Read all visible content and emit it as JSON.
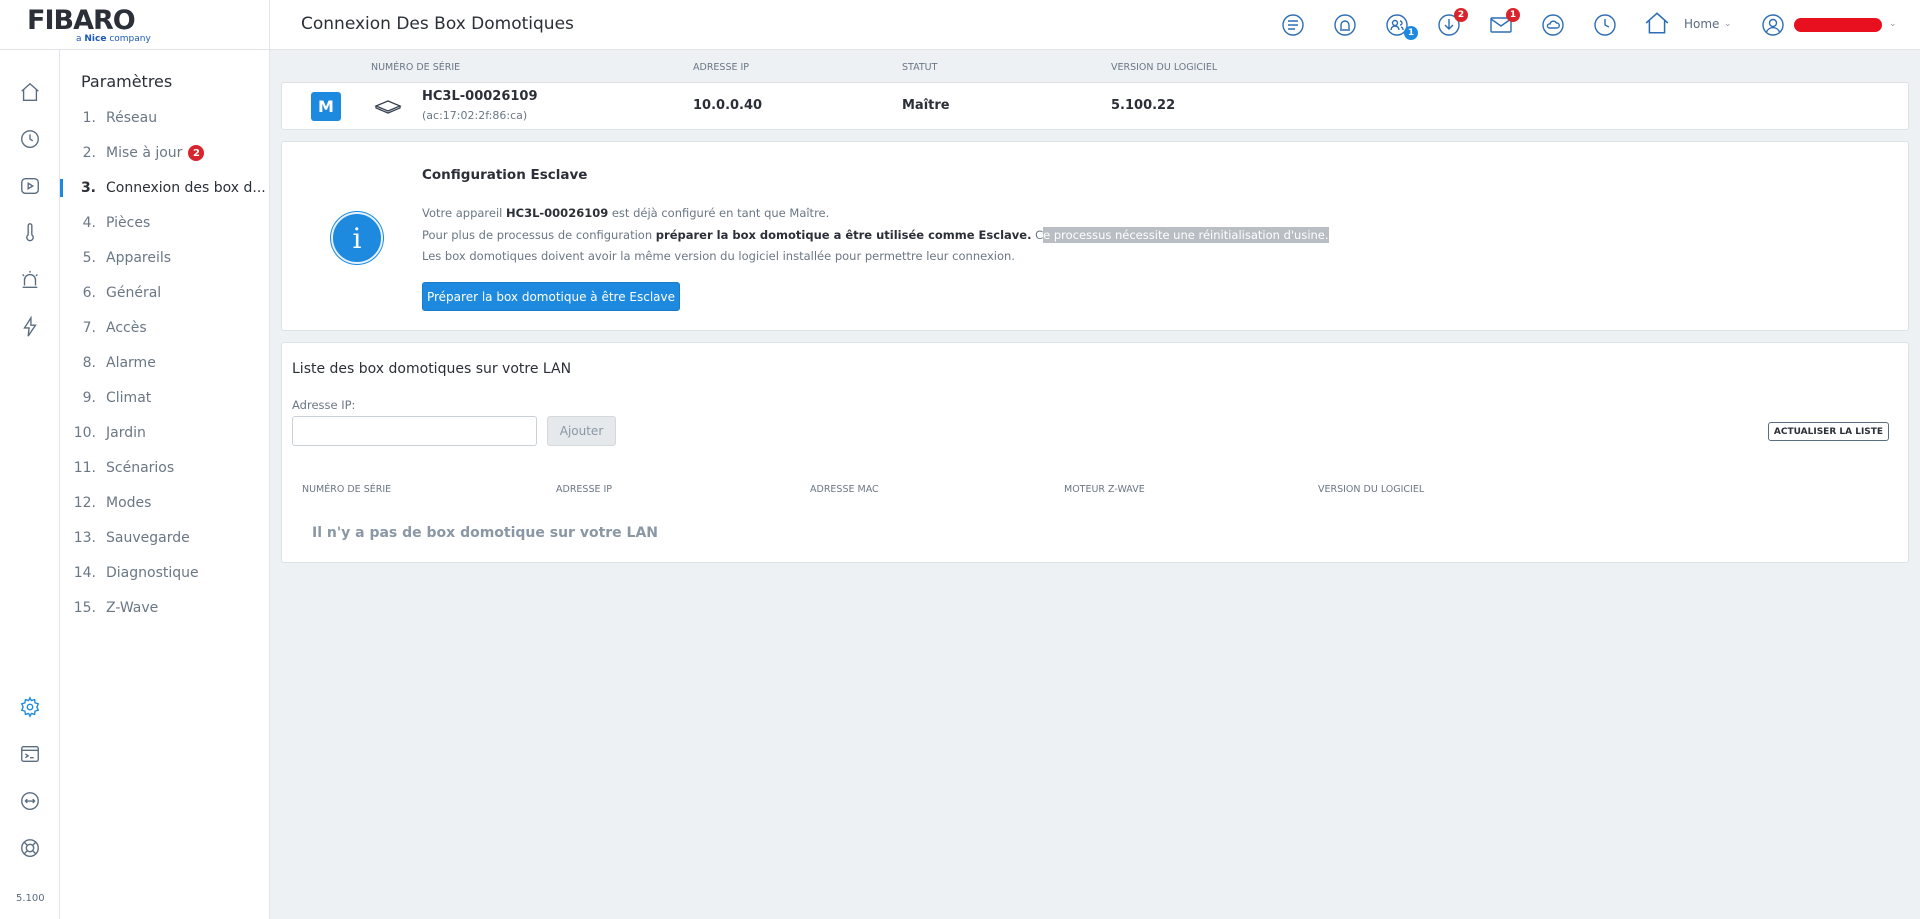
{
  "brand": {
    "logo": "FIBARO",
    "sub_prefix": "a",
    "sub_bold": "Nice",
    "sub_suffix": "company"
  },
  "app_version": "5.100",
  "header": {
    "title": "Connexion Des Box Domotiques",
    "home_label": "Home",
    "badges": {
      "users": "1",
      "downloads": "2",
      "messages": "1"
    }
  },
  "nav": {
    "title": "Paramètres",
    "items": [
      {
        "num": "1.",
        "label": "Réseau"
      },
      {
        "num": "2.",
        "label": "Mise à jour",
        "badge": "2"
      },
      {
        "num": "3.",
        "label": "Connexion des box d..."
      },
      {
        "num": "4.",
        "label": "Pièces"
      },
      {
        "num": "5.",
        "label": "Appareils"
      },
      {
        "num": "6.",
        "label": "Général"
      },
      {
        "num": "7.",
        "label": "Accès"
      },
      {
        "num": "8.",
        "label": "Alarme"
      },
      {
        "num": "9.",
        "label": "Climat"
      },
      {
        "num": "10.",
        "label": "Jardin"
      },
      {
        "num": "11.",
        "label": "Scénarios"
      },
      {
        "num": "12.",
        "label": "Modes"
      },
      {
        "num": "13.",
        "label": "Sauvegarde"
      },
      {
        "num": "14.",
        "label": "Diagnostique"
      },
      {
        "num": "15.",
        "label": "Z-Wave"
      }
    ]
  },
  "device_table": {
    "headers": {
      "serial": "NUMÉRO DE SÉRIE",
      "ip": "ADRESSE IP",
      "status": "STATUT",
      "version": "VERSION DU LOGICIEL"
    },
    "row": {
      "role_letter": "M",
      "serial": "HC3L-00026109",
      "mac": "(ac:17:02:2f:86:ca)",
      "ip": "10.0.0.40",
      "status": "Maître",
      "version": "5.100.22"
    }
  },
  "config": {
    "title": "Configuration Esclave",
    "line1_a": "Votre appareil ",
    "line1_b": "HC3L-00026109",
    "line1_c": " est déjà configuré en tant que Maître.",
    "line2_a": "Pour plus de processus de configuration ",
    "line2_b": "préparer la box domotique a être utilisée comme Esclave.",
    "line2_c": " C",
    "line2_d": "e processus nécessite une réinitialisation d'usine.",
    "line3": "Les box domotiques doivent avoir la même version du logiciel installée pour permettre leur connexion.",
    "button": "Préparer la box domotique à être Esclave"
  },
  "lan": {
    "title": "Liste des box domotiques sur votre LAN",
    "ip_label": "Adresse IP:",
    "ip_value": "",
    "add_button": "Ajouter",
    "refresh_button": "ACTUALISER LA LISTE",
    "headers": {
      "serial": "NUMÉRO DE SÉRIE",
      "ip": "ADRESSE IP",
      "mac": "ADRESSE MAC",
      "zwave": "MOTEUR Z-WAVE",
      "version": "VERSION DU LOGICIEL"
    },
    "empty": "Il n'y a pas de box domotique sur votre LAN"
  }
}
